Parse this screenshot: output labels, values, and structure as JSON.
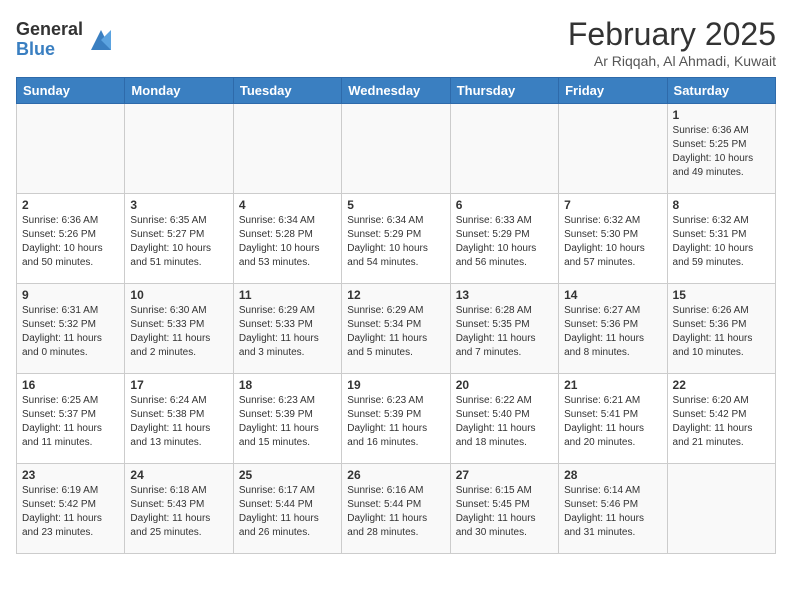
{
  "header": {
    "logo_general": "General",
    "logo_blue": "Blue",
    "title": "February 2025",
    "location": "Ar Riqqah, Al Ahmadi, Kuwait"
  },
  "days_of_week": [
    "Sunday",
    "Monday",
    "Tuesday",
    "Wednesday",
    "Thursday",
    "Friday",
    "Saturday"
  ],
  "weeks": [
    [
      {
        "day": "",
        "info": ""
      },
      {
        "day": "",
        "info": ""
      },
      {
        "day": "",
        "info": ""
      },
      {
        "day": "",
        "info": ""
      },
      {
        "day": "",
        "info": ""
      },
      {
        "day": "",
        "info": ""
      },
      {
        "day": "1",
        "info": "Sunrise: 6:36 AM\nSunset: 5:25 PM\nDaylight: 10 hours and 49 minutes."
      }
    ],
    [
      {
        "day": "2",
        "info": "Sunrise: 6:36 AM\nSunset: 5:26 PM\nDaylight: 10 hours and 50 minutes."
      },
      {
        "day": "3",
        "info": "Sunrise: 6:35 AM\nSunset: 5:27 PM\nDaylight: 10 hours and 51 minutes."
      },
      {
        "day": "4",
        "info": "Sunrise: 6:34 AM\nSunset: 5:28 PM\nDaylight: 10 hours and 53 minutes."
      },
      {
        "day": "5",
        "info": "Sunrise: 6:34 AM\nSunset: 5:29 PM\nDaylight: 10 hours and 54 minutes."
      },
      {
        "day": "6",
        "info": "Sunrise: 6:33 AM\nSunset: 5:29 PM\nDaylight: 10 hours and 56 minutes."
      },
      {
        "day": "7",
        "info": "Sunrise: 6:32 AM\nSunset: 5:30 PM\nDaylight: 10 hours and 57 minutes."
      },
      {
        "day": "8",
        "info": "Sunrise: 6:32 AM\nSunset: 5:31 PM\nDaylight: 10 hours and 59 minutes."
      }
    ],
    [
      {
        "day": "9",
        "info": "Sunrise: 6:31 AM\nSunset: 5:32 PM\nDaylight: 11 hours and 0 minutes."
      },
      {
        "day": "10",
        "info": "Sunrise: 6:30 AM\nSunset: 5:33 PM\nDaylight: 11 hours and 2 minutes."
      },
      {
        "day": "11",
        "info": "Sunrise: 6:29 AM\nSunset: 5:33 PM\nDaylight: 11 hours and 3 minutes."
      },
      {
        "day": "12",
        "info": "Sunrise: 6:29 AM\nSunset: 5:34 PM\nDaylight: 11 hours and 5 minutes."
      },
      {
        "day": "13",
        "info": "Sunrise: 6:28 AM\nSunset: 5:35 PM\nDaylight: 11 hours and 7 minutes."
      },
      {
        "day": "14",
        "info": "Sunrise: 6:27 AM\nSunset: 5:36 PM\nDaylight: 11 hours and 8 minutes."
      },
      {
        "day": "15",
        "info": "Sunrise: 6:26 AM\nSunset: 5:36 PM\nDaylight: 11 hours and 10 minutes."
      }
    ],
    [
      {
        "day": "16",
        "info": "Sunrise: 6:25 AM\nSunset: 5:37 PM\nDaylight: 11 hours and 11 minutes."
      },
      {
        "day": "17",
        "info": "Sunrise: 6:24 AM\nSunset: 5:38 PM\nDaylight: 11 hours and 13 minutes."
      },
      {
        "day": "18",
        "info": "Sunrise: 6:23 AM\nSunset: 5:39 PM\nDaylight: 11 hours and 15 minutes."
      },
      {
        "day": "19",
        "info": "Sunrise: 6:23 AM\nSunset: 5:39 PM\nDaylight: 11 hours and 16 minutes."
      },
      {
        "day": "20",
        "info": "Sunrise: 6:22 AM\nSunset: 5:40 PM\nDaylight: 11 hours and 18 minutes."
      },
      {
        "day": "21",
        "info": "Sunrise: 6:21 AM\nSunset: 5:41 PM\nDaylight: 11 hours and 20 minutes."
      },
      {
        "day": "22",
        "info": "Sunrise: 6:20 AM\nSunset: 5:42 PM\nDaylight: 11 hours and 21 minutes."
      }
    ],
    [
      {
        "day": "23",
        "info": "Sunrise: 6:19 AM\nSunset: 5:42 PM\nDaylight: 11 hours and 23 minutes."
      },
      {
        "day": "24",
        "info": "Sunrise: 6:18 AM\nSunset: 5:43 PM\nDaylight: 11 hours and 25 minutes."
      },
      {
        "day": "25",
        "info": "Sunrise: 6:17 AM\nSunset: 5:44 PM\nDaylight: 11 hours and 26 minutes."
      },
      {
        "day": "26",
        "info": "Sunrise: 6:16 AM\nSunset: 5:44 PM\nDaylight: 11 hours and 28 minutes."
      },
      {
        "day": "27",
        "info": "Sunrise: 6:15 AM\nSunset: 5:45 PM\nDaylight: 11 hours and 30 minutes."
      },
      {
        "day": "28",
        "info": "Sunrise: 6:14 AM\nSunset: 5:46 PM\nDaylight: 11 hours and 31 minutes."
      },
      {
        "day": "",
        "info": ""
      }
    ]
  ]
}
